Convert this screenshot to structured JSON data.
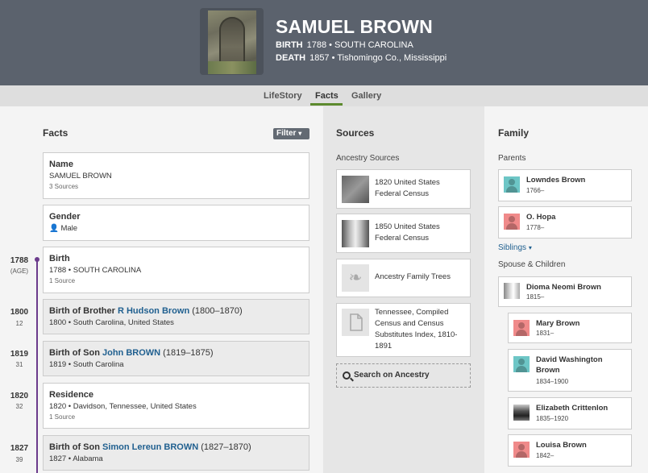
{
  "person": {
    "name": "SAMUEL BROWN",
    "birth_label": "BIRTH",
    "birth_value": "1788 • SOUTH CAROLINA",
    "death_label": "DEATH",
    "death_value": "1857 • Tishomingo Co., Mississippi"
  },
  "tabs": [
    "LifeStory",
    "Facts",
    "Gallery"
  ],
  "facts": {
    "title": "Facts",
    "filter_label": "Filter",
    "items": [
      {
        "title": "Name",
        "line": "SAMUEL BROWN",
        "sources": "3 Sources"
      },
      {
        "title": "Gender",
        "line": "Male"
      },
      {
        "year": "1788",
        "age": "(AGE)",
        "title": "Birth",
        "line": "1788 • SOUTH CAROLINA",
        "sources": "1 Source"
      },
      {
        "year": "1800",
        "age": "12",
        "title": "Birth of Brother",
        "rel": "R Hudson Brown",
        "range": "(1800–1870)",
        "line": "1800 • South Carolina, United States"
      },
      {
        "year": "1819",
        "age": "31",
        "title": "Birth of Son",
        "rel": "John BROWN",
        "range": "(1819–1875)",
        "line": "1819 • South Carolina"
      },
      {
        "year": "1820",
        "age": "32",
        "title": "Residence",
        "line": "1820 • Davidson, Tennessee, United States",
        "sources": "1 Source"
      },
      {
        "year": "1827",
        "age": "39",
        "title": "Birth of Son",
        "rel": "Simon Lereun BROWN",
        "range": "(1827–1870)",
        "line": "1827 • Alabama"
      }
    ]
  },
  "sources": {
    "title": "Sources",
    "subtitle": "Ancestry Sources",
    "items": [
      {
        "text": "1820 United States Federal Census"
      },
      {
        "text": "1850 United States Federal Census"
      },
      {
        "text": "Ancestry Family Trees"
      },
      {
        "text": "Tennessee, Compiled Census and Census Substitutes Index, 1810-1891"
      }
    ],
    "search_label": "Search on Ancestry"
  },
  "family": {
    "title": "Family",
    "parents_label": "Parents",
    "parents": [
      {
        "name": "Lowndes Brown",
        "dates": "1766–"
      },
      {
        "name": "O. Hopa",
        "dates": "1778–"
      }
    ],
    "siblings_label": "Siblings",
    "spouse_label": "Spouse & Children",
    "spouse": {
      "name": "Dioma Neomi Brown",
      "dates": "1815–"
    },
    "children": [
      {
        "name": "Mary Brown",
        "dates": "1831–"
      },
      {
        "name": "David Washington Brown",
        "dates": "1834–1900"
      },
      {
        "name": "Elizabeth Crittenlon",
        "dates": "1835–1920"
      },
      {
        "name": "Louisa Brown",
        "dates": "1842–"
      }
    ]
  },
  "colors": {
    "header": "#5b626d",
    "timeline": "#6b3b8c",
    "link": "#1f5f8f",
    "tab_accent": "#5c8a2e"
  }
}
